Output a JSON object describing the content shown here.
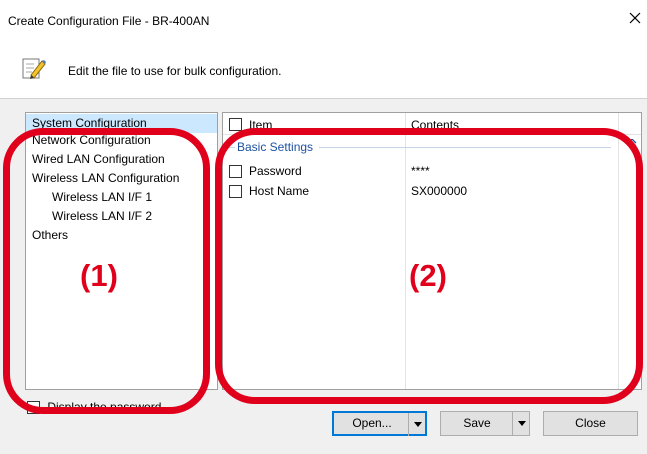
{
  "window": {
    "title": "Create Configuration File - BR-400AN"
  },
  "header": {
    "instruction": "Edit the file to use for bulk configuration."
  },
  "tree": {
    "items": [
      {
        "label": "System Configuration",
        "selected": true
      },
      {
        "label": "Network Configuration"
      },
      {
        "label": "Wired LAN Configuration"
      },
      {
        "label": "Wireless LAN Configuration"
      },
      {
        "label": "Wireless LAN I/F 1"
      },
      {
        "label": "Wireless LAN I/F 2"
      },
      {
        "label": "Others"
      }
    ]
  },
  "grid": {
    "columns": {
      "item": "Item",
      "contents": "Contents"
    },
    "group": "Basic Settings",
    "rows": [
      {
        "item": "Password",
        "contents": "****"
      },
      {
        "item": "Host Name",
        "contents": "SX000000"
      }
    ]
  },
  "display_password": "Display the password",
  "buttons": {
    "open": "Open...",
    "save": "Save",
    "close": "Close"
  },
  "annotations": {
    "left": "(1)",
    "right": "(2)"
  },
  "colors": {
    "annotation": "#e0001b",
    "selection": "#cce8ff",
    "group_text": "#1e50a0"
  }
}
